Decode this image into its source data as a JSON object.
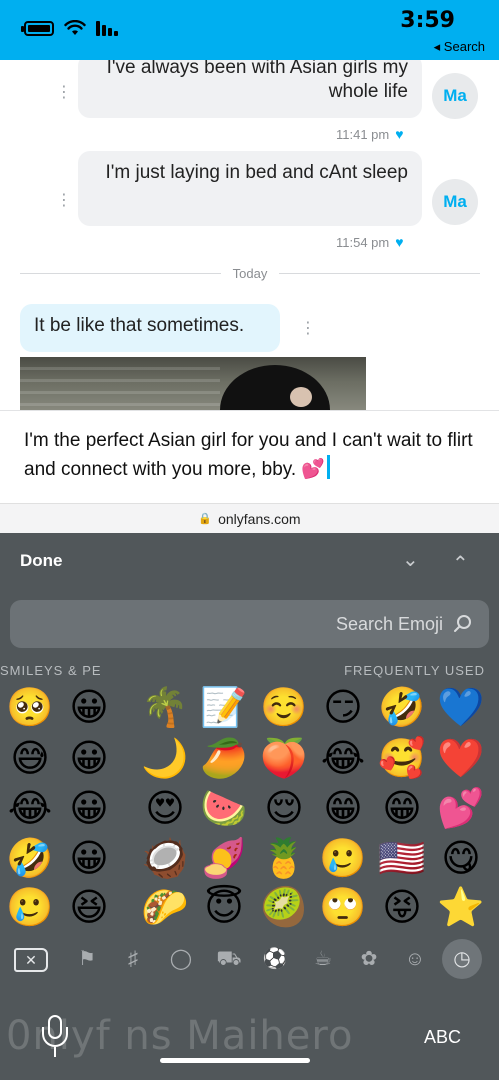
{
  "status_bar": {
    "time": "3:59",
    "back_label": "◂ Search"
  },
  "chat": {
    "messages": [
      {
        "avatar": "Ma",
        "text": "I've always been with Asian girls my whole life",
        "time": "11:41 pm"
      },
      {
        "avatar": "Ma",
        "text": "I'm just laying in bed and cAnt sleep",
        "time": "11:54 pm"
      }
    ],
    "date_divider": "Today",
    "my_message": "It be like that sometimes."
  },
  "composer": {
    "text": "I'm the perfect Asian girl for you and I can't wait to flirt and connect with you more, bby.",
    "emoji": "💕"
  },
  "url_bar": {
    "domain": "onlyfans.com"
  },
  "keyboard": {
    "done_label": "Done",
    "search_placeholder": "Search Emoji",
    "category_labels": [
      "FREQUENTLY USED",
      "SMILEYS & PE"
    ],
    "emoji_rows": [
      [
        "💙",
        "🤣",
        "😏",
        "☺️",
        "📝",
        "🌴",
        "😀",
        "🥺"
      ],
      [
        "❤️",
        "🥰",
        "😂",
        "🍑",
        "🥭",
        "🌙",
        "😀",
        "😅"
      ],
      [
        "💕",
        "😁",
        "😁",
        "😌",
        "🍉",
        "😍",
        "😀",
        "😂"
      ],
      [
        "😋",
        "🇺🇸",
        "🥲",
        "🍍",
        "🍠",
        "🥥",
        "😀",
        "🤣"
      ],
      [
        "⭐",
        "😝",
        "🙄",
        "🥝",
        "😇",
        "🌮",
        "😆",
        "🥲"
      ]
    ],
    "abc_label": "ABC",
    "watermark": "0nlyf ns Maihero"
  }
}
